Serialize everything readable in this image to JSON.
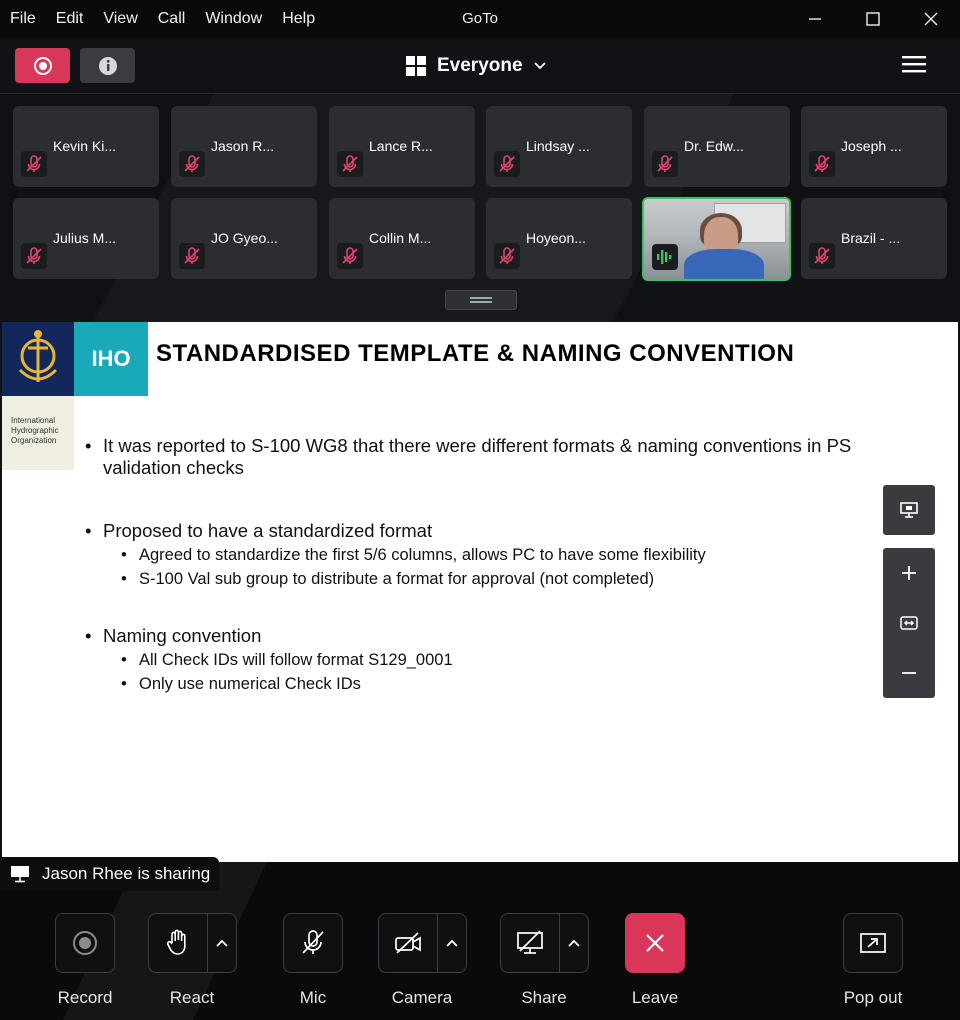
{
  "menubar": {
    "items": [
      "File",
      "Edit",
      "View",
      "Call",
      "Window",
      "Help"
    ],
    "title": "GoTo"
  },
  "toolbar": {
    "view_label": "Everyone"
  },
  "participants": [
    {
      "name": "Kevin Ki..."
    },
    {
      "name": "Jason R..."
    },
    {
      "name": "Lance R..."
    },
    {
      "name": "Lindsay ..."
    },
    {
      "name": "Dr. Edw..."
    },
    {
      "name": "Joseph ..."
    },
    {
      "name": "Julius M..."
    },
    {
      "name": "JO Gyeo..."
    },
    {
      "name": "Collin M..."
    },
    {
      "name": "Hoyeon..."
    },
    {
      "name": ""
    },
    {
      "name": "Brazil - ..."
    }
  ],
  "slide": {
    "logo_text": "IHO",
    "org_lines": [
      "International",
      "Hydrographic",
      "Organization"
    ],
    "title": "STANDARDISED TEMPLATE & NAMING CONVENTION",
    "bullets": [
      {
        "text": "It was reported to S-100 WG8 that there were different formats & naming conventions in PS validation checks",
        "sub": []
      },
      {
        "text": "Proposed to have a standardized format",
        "sub": [
          "Agreed to standardize the first 5/6 columns, allows PC to have some flexibility",
          "S-100 Val sub group to distribute a format for approval (not completed)"
        ]
      },
      {
        "text": "Naming convention",
        "sub": [
          "All Check IDs will follow format S129_0001",
          "Only use numerical Check IDs"
        ]
      }
    ]
  },
  "sharing": {
    "text": "Jason Rhee is sharing"
  },
  "controls": {
    "record": "Record",
    "react": "React",
    "mic": "Mic",
    "camera": "Camera",
    "share": "Share",
    "leave": "Leave",
    "popout": "Pop out"
  },
  "colors": {
    "accent_red": "#d8375a",
    "speaking_green": "#3fbf5f",
    "iho_navy": "#12285a",
    "iho_teal": "#1aa9b9"
  }
}
